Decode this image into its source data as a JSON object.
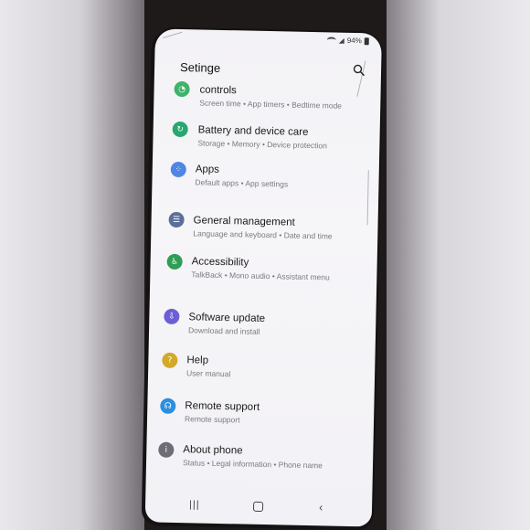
{
  "status": {
    "battery": "94%"
  },
  "app_title": "Setinge",
  "menu": [
    {
      "title": "controls",
      "subtitle": "Screen time  •  App timers  •  Bedtime mode",
      "icon": "digital-wellbeing-icon",
      "color": "#3fb36a"
    },
    {
      "title": "Battery and device care",
      "subtitle": "Storage  •  Memory  •  Device protection",
      "icon": "device-care-icon",
      "color": "#27a86e"
    },
    {
      "title": "Apps",
      "subtitle": "Default apps  •  App settings",
      "icon": "apps-icon",
      "color": "#4f86e6"
    },
    {
      "title": "General management",
      "subtitle": "Language and keyboard  •  Date and time",
      "icon": "general-management-icon",
      "color": "#5b6f9a"
    },
    {
      "title": "Accessibility",
      "subtitle": "TalkBack  •  Mono audio  •  Assistant menu",
      "icon": "accessibility-icon",
      "color": "#2f9e54"
    },
    {
      "title": "Software update",
      "subtitle": "Download and install",
      "icon": "software-update-icon",
      "color": "#6b5fd6"
    },
    {
      "title": "Help",
      "subtitle": "User manual",
      "icon": "help-icon",
      "color": "#d2a928"
    },
    {
      "title": "Remote support",
      "subtitle": "Remote support",
      "icon": "remote-support-icon",
      "color": "#2b8ee0"
    },
    {
      "title": "About phone",
      "subtitle": "Status  •  Legal information  •  Phone name",
      "icon": "about-phone-icon",
      "color": "#6d6d78"
    }
  ]
}
